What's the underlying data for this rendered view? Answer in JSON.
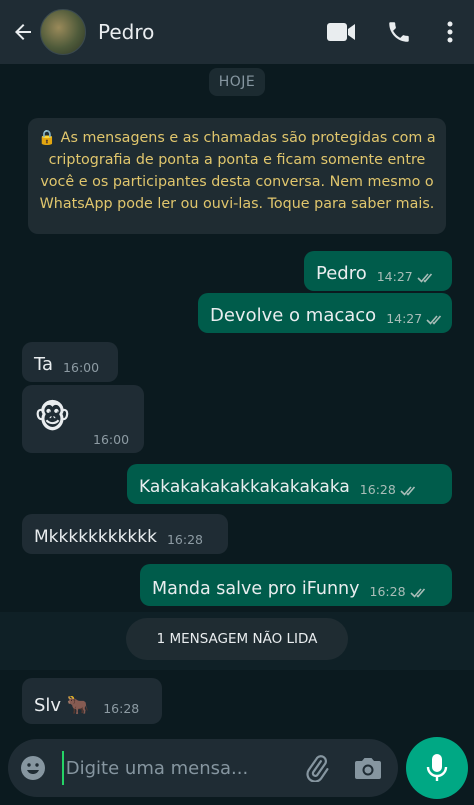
{
  "header": {
    "contact_name": "Pedro",
    "icons": [
      "back-arrow-icon",
      "video-call-icon",
      "phone-icon",
      "more-vert-icon"
    ]
  },
  "chat": {
    "date_label": "HOJE",
    "encryption_notice": "🔒 As mensagens e as chamadas são protegidas com a criptografia de ponta a ponta e ficam somente entre você e os participantes desta conversa. Nem mesmo o WhatsApp pode ler ou ouvi-las. Toque para saber mais.",
    "messages": [
      {
        "direction": "out",
        "text": "Pedro",
        "time": "14:27",
        "status": "read"
      },
      {
        "direction": "out",
        "text": "Devolve o macaco",
        "time": "14:27",
        "status": "read"
      },
      {
        "direction": "in",
        "text": "Ta",
        "time": "16:00"
      },
      {
        "direction": "in",
        "text": "🐵",
        "time": "16:00"
      },
      {
        "direction": "out",
        "text": "Kakakakakakkakakakaka",
        "time": "16:28",
        "status": "read"
      },
      {
        "direction": "in",
        "text": "Mkkkkkkkkkkk",
        "time": "16:28"
      },
      {
        "direction": "out",
        "text": "Manda salve pro iFunny",
        "time": "16:28",
        "status": "read"
      },
      {
        "direction": "in",
        "text": "Slv 🐂",
        "time": "16:28"
      }
    ],
    "unread_label": "1 MENSAGEM NÃO LIDA"
  },
  "composer": {
    "placeholder": "Digite uma mensa...",
    "value": "",
    "icons": [
      "emoji-icon",
      "paperclip-icon",
      "camera-icon",
      "mic-icon"
    ]
  },
  "colors": {
    "background": "#0b1a1f",
    "header": "#1f2c34",
    "outgoing_bubble": "#005c4b",
    "incoming_bubble": "#1f2c34",
    "notice_text": "#e0c66d",
    "accent": "#00a884",
    "read_ticks": "#a9bdb8"
  }
}
